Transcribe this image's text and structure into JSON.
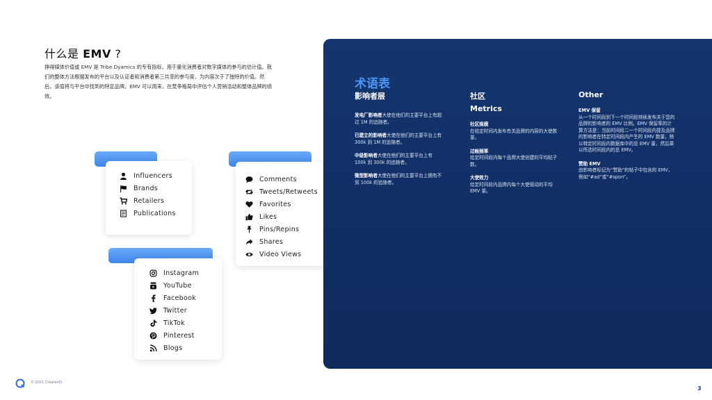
{
  "intro": {
    "title_prefix": "什么是 ",
    "title_bold": "EMV",
    "title_suffix": " ?",
    "body": "挣得媒体价值或 EMV 是 Tribe Dyamics 的专有指标，用于量化消费者对数字媒体的参与的估计值。我们的整体方法根据发布的平台以及认证者和消费者第三共享的参与度，为内容次于了独特的价值。然后，该值将与平台中找到的特定品牌。EMV 可以用来，在竞争格局中评估个人营销活动和整体品牌的绩效。"
  },
  "cards": {
    "sources": {
      "items": [
        {
          "icon": "person-icon",
          "label": "Influencers"
        },
        {
          "icon": "flag-icon",
          "label": "Brands"
        },
        {
          "icon": "shopping-cart-icon",
          "label": "Retailers"
        },
        {
          "icon": "newspaper-icon",
          "label": "Publications"
        }
      ]
    },
    "engagement": {
      "items": [
        {
          "icon": "comment-icon",
          "label": "Comments"
        },
        {
          "icon": "retweet-icon",
          "label": "Tweets/Retweets"
        },
        {
          "icon": "heart-icon",
          "label": "Favorites"
        },
        {
          "icon": "thumbs-up-icon",
          "label": "Likes"
        },
        {
          "icon": "pin-icon",
          "label": "Pins/Repins"
        },
        {
          "icon": "share-icon",
          "label": "Shares"
        },
        {
          "icon": "eye-icon",
          "label": "Video Views"
        }
      ]
    },
    "platforms": {
      "items": [
        {
          "icon": "instagram-icon",
          "label": "Instagram"
        },
        {
          "icon": "youtube-icon",
          "label": "YouTube"
        },
        {
          "icon": "facebook-icon",
          "label": "Facebook"
        },
        {
          "icon": "twitter-icon",
          "label": "Twitter"
        },
        {
          "icon": "tiktok-icon",
          "label": "TikTok"
        },
        {
          "icon": "pinterest-icon",
          "label": "Pinterest"
        },
        {
          "icon": "rss-icon",
          "label": "Blogs"
        }
      ]
    }
  },
  "glossary": {
    "title": "术语表",
    "col1": {
      "heading": "影响者层",
      "terms": [
        {
          "term": "发电厂影响者",
          "desc": "大使在他们的主要平台上有超过 1M 的追随者。"
        },
        {
          "term": "已建立的影响者",
          "desc": "大使在他们的主要平台上有 300k 到 1M 的追随者。"
        },
        {
          "term": "中级影响者",
          "desc": "大使在他们的主要平台上有 100k 到 300k 的追随者。"
        },
        {
          "term": "微型影响者",
          "desc": "大使在他们的主要平台上拥有不到 100k 的追随者。"
        }
      ]
    },
    "col2": {
      "heading": "社区",
      "subheading": "Metrics",
      "terms": [
        {
          "term": "社区规模",
          "desc": "在给定时间内发布有关品牌的内容的大使数量。"
        },
        {
          "term": "过帐频率",
          "desc": "给定时间段内每个品牌大使创建的平均帖子数。"
        },
        {
          "term": "大使效力",
          "desc": "给定时间段内品牌内每个大使驱动的平均 EMV 量。"
        }
      ]
    },
    "col3": {
      "heading": "Other",
      "terms": [
        {
          "term": "EMV 保留",
          "desc": "从一个时间段到下一个时间段持续发布关于您的品牌的影响者的 EMV 比例。EMV 保留率的计算方法是：当前时间段二一个时间段内提及品牌的影响者在特定时间段内产生的 EMV 数量，除以特定时间段内数据库中的总 EMV 量，然后乘以所选时间段内的总 EMV。"
        },
        {
          "term": "赞助 EMV",
          "desc": "由影响者标记为“赞助”的帖子中包含的 EMV，例如“#ad”或“#spon”。"
        }
      ]
    }
  },
  "footer": {
    "copyright": "© 2021 CreatorIQ",
    "page_number": "3"
  }
}
